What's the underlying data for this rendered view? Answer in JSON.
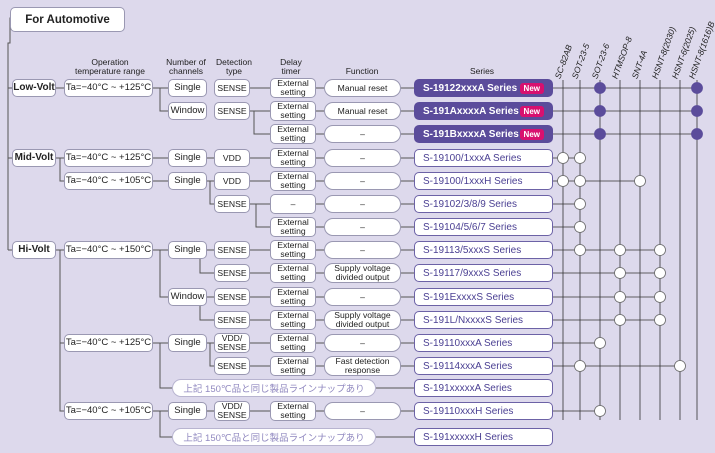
{
  "title": "For Automotive",
  "headers": {
    "temp": "Operation\ntemperature range",
    "channels": "Number of\nchannels",
    "detection": "Detection\ntype",
    "delay": "Delay\ntimer",
    "function": "Function",
    "series": "Series"
  },
  "packages": [
    "SC-82AB",
    "SOT-23-5",
    "SOT-23-6",
    "HTMSOP-8",
    "SNT-4A",
    "HSNT-8(2030)",
    "HSNT-6(2025)",
    "HSNT-8(1616)B"
  ],
  "categories": {
    "low": "Low-Volt",
    "mid": "Mid-Volt",
    "hi": "Hi-Volt"
  },
  "temps": [
    "Ta=−40°C ~ +125°C",
    "Ta=−40°C ~ +125°C",
    "Ta=−40°C ~ +105°C",
    "Ta=−40°C ~ +150°C",
    "Ta=−40°C ~ +125°C",
    "Ta=−40°C ~ +105°C"
  ],
  "labels": {
    "single": "Single",
    "window": "Window",
    "sense": "SENSE",
    "vdd": "VDD",
    "vdd_sense": "VDD/\nSENSE",
    "ext": "External\nsetting",
    "dash": "–",
    "manual": "Manual reset",
    "divided": "Supply voltage\ndivided output",
    "fast": "Fast detection\nresponse",
    "new": "New"
  },
  "notes": [
    "上記 150℃品と同じ製品ラインナップあり",
    "上記 150℃品と同じ製品ラインナップあり"
  ],
  "series": [
    {
      "name": "S-19122xxxA Series",
      "dark": true,
      "new": true,
      "dots": [
        2,
        7
      ],
      "dot_style": "filled"
    },
    {
      "name": "S-191AxxxxA Series",
      "dark": true,
      "new": true,
      "dots": [
        2,
        7
      ],
      "dot_style": "filled"
    },
    {
      "name": "S-191BxxxxA Series",
      "dark": true,
      "new": true,
      "dots": [
        2,
        7
      ],
      "dot_style": "filled"
    },
    {
      "name": "S-19100/1xxxA Series",
      "dots": [
        0,
        1
      ],
      "dot_style": "open"
    },
    {
      "name": "S-19100/1xxxH Series",
      "dots": [
        0,
        1,
        4
      ],
      "dot_style": "open"
    },
    {
      "name": "S-19102/3/8/9 Series",
      "dots": [
        1
      ],
      "dot_style": "open"
    },
    {
      "name": "S-19104/5/6/7 Series",
      "dots": [
        1
      ],
      "dot_style": "open"
    },
    {
      "name": "S-19113/5xxxS Series",
      "dots": [
        1,
        3,
        5
      ],
      "dot_style": "open"
    },
    {
      "name": "S-19117/9xxxS Series",
      "dots": [
        3,
        5
      ],
      "dot_style": "open"
    },
    {
      "name": "S-191ExxxxS Series",
      "dots": [
        3,
        5
      ],
      "dot_style": "open"
    },
    {
      "name": "S-191L/NxxxxS Series",
      "dots": [
        3,
        5
      ],
      "dot_style": "open"
    },
    {
      "name": "S-19110xxxA Series",
      "dots": [
        2
      ],
      "dot_style": "open"
    },
    {
      "name": "S-19114xxxA Series",
      "dots": [
        1,
        6
      ],
      "dot_style": "open"
    },
    {
      "name": "S-191xxxxxA Series",
      "dots": [],
      "dot_style": "open"
    },
    {
      "name": "S-19110xxxH Series",
      "dots": [
        2
      ],
      "dot_style": "open"
    },
    {
      "name": "S-191xxxxxH Series",
      "dots": [],
      "dot_style": "open"
    }
  ]
}
